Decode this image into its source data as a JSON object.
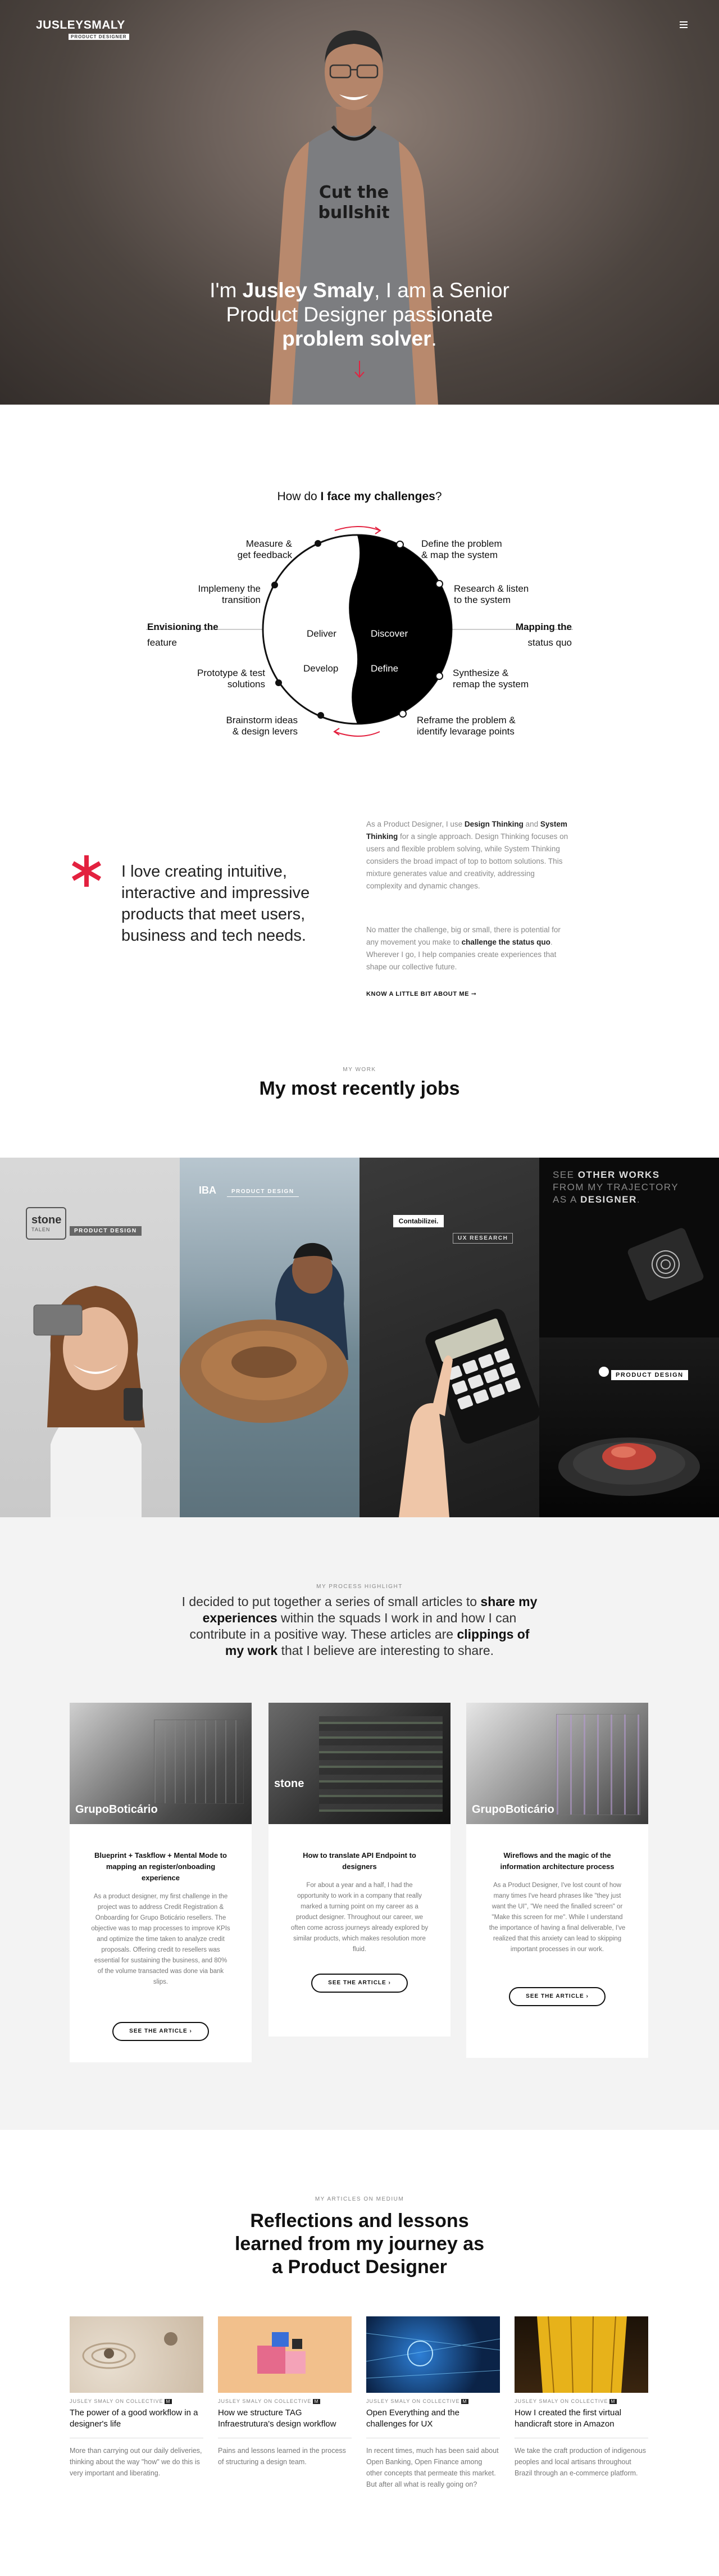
{
  "header": {
    "logo_main": "JUSLEYSMALY",
    "logo_sub": "PRODUCT DESIGNER",
    "menu_icon": "hamburger-menu-icon"
  },
  "hero": {
    "line1_pre": "I'm ",
    "name": "Jusley Smaly",
    "line1_post": ", I am a Senior",
    "line2": "Product Designer passionate",
    "line3": "problem solver",
    "line3_post": ".",
    "shirt_line1": "Cut the",
    "shirt_line2": "bullshit",
    "accent": "#e3213f"
  },
  "challenges": {
    "title_pre": "How do ",
    "title_bold": "I face my challenges",
    "title_post": "?",
    "left_label_bold": "Envisioning the",
    "left_label": "feature",
    "right_label_bold": "Mapping the",
    "right_label": "status quo",
    "deliver": "Deliver",
    "develop": "Develop",
    "discover": "Discover",
    "define": "Define",
    "steps_left": [
      "Measure &\nget feedback",
      "Implemeny the\ntransition",
      "Prototype & test\nsolutions",
      "Brainstorm ideas\n& design levers"
    ],
    "steps_right": [
      "Define the problem\n& map the system",
      "Research & listen\nto the system",
      "Synthesize &\nremap the system",
      "Reframe the problem &\nidentify levarage points"
    ]
  },
  "intro": {
    "headline": "I love creating intuitive, interactive and impressive products that meet users, business and tech needs.",
    "p1_a": "As a Product Designer, I use ",
    "p1_b": "Design Thinking",
    "p1_c": " and ",
    "p1_d": "System Thinking",
    "p1_e": " for a single approach. Design Thinking focuses on users and flexible problem solving, while System Thinking considers the broad impact of top to bottom solutions. This mixture generates value and creativity, addressing complexity and dynamic changes.",
    "p2_a": "No matter the challenge, big or small, there is potential for any movement you make to ",
    "p2_b": "challenge the status quo",
    "p2_c": ". Wherever I go, I help companies create experiences that shape our collective future.",
    "link": "KNOW A LITTLE BIT ABOUT ME"
  },
  "jobs": {
    "kicker": "MY WORK",
    "title": "My most recently jobs",
    "items": [
      {
        "brand": "stone",
        "brand_sub": "TALEN",
        "tag": "PRODUCT DESIGN"
      },
      {
        "brand": "IBA",
        "tag": "PRODUCT DESIGN"
      },
      {
        "brand": "Contabilizei.",
        "tag": "UX RESEARCH"
      },
      {
        "see_line1_a": "SEE ",
        "see_line1_b": "OTHER WORKS",
        "see_line2": "FROM MY TRAJECTORY",
        "see_line3_a": "AS A ",
        "see_line3_b": "DESIGNER",
        "see_line3_c": ".",
        "tag": "PRODUCT DESIGN"
      }
    ]
  },
  "process": {
    "kicker": "MY PROCESS HIGHLIGHT",
    "intro_a": "I decided to put together a series of small articles to ",
    "intro_b": "share my experiences",
    "intro_c": " within the squads I work in and how I can contribute in a positive way. These articles are ",
    "intro_d": "clippings of my work",
    "intro_e": " that I believe are interesting to share.",
    "cards": [
      {
        "brand": "GrupoBoticário",
        "title": "Blueprint + Taskflow + Mental Mode to mapping an register/onboading experience",
        "text": "As a product designer, my first challenge in the project was to address Credit Registration & Onboarding for Grupo Boticário resellers. The objective was to map processes to improve KPIs and optimize the time taken to analyze credit proposals. Offering credit to resellers was essential for sustaining the business, and 80% of the volume transacted was done via bank slips.",
        "cta": "SEE THE ARTICLE"
      },
      {
        "brand": "stone",
        "title": "How to translate API Endpoint to designers",
        "text": "For about a year and a half, I had the opportunity to work in a company that really marked a turning point on my career as a product designer. Throughout our career, we often come across journeys already explored by similar products, which makes resolution more fluid.",
        "cta": "SEE THE ARTICLE"
      },
      {
        "brand": "GrupoBoticário",
        "title": "Wireflows and the magic of the information architecture process",
        "text": "As a Product Designer, I've lost count of how many times I've heard phrases like \"they just want the UI\", \"We need the finalled screen\" or \"Make this screen for me\". While I understand the importance of having a final deliverable, I've realized that this anxiety can lead to skipping important processes in our work.",
        "cta": "SEE THE ARTICLE"
      }
    ]
  },
  "medium": {
    "kicker": "MY ARTICLES ON MEDIUM",
    "title_1": "Reflections and lessons",
    "title_2": "learned from my journey as",
    "title_3": "a Product Designer",
    "articles": [
      {
        "meta": "JUSLEY SMALY ON COLLECTIVE",
        "title": "The power of a good workflow in a designer's life",
        "text": "More than carrying out our daily deliveries, thinking about the way \"how\" we do this is very important and liberating."
      },
      {
        "meta": "JUSLEY SMALY ON COLLECTIVE",
        "title": "How we structure TAG Infraestrutura's design workflow",
        "text": "Pains and lessons learned in the process of structuring a design team."
      },
      {
        "meta": "JUSLEY SMALY ON COLLECTIVE",
        "title": "Open Everything and the challenges for UX",
        "text": "In recent times, much has been said about Open Banking, Open Finance among other concepts that permeate this market. But after all what is really going on?"
      },
      {
        "meta": "JUSLEY SMALY ON COLLECTIVE",
        "title": "How I created the first virtual handicraft store in Amazon",
        "text": "We take the craft production of indigenous peoples and local artisans throughout Brazil through an e-commerce platform."
      }
    ]
  }
}
